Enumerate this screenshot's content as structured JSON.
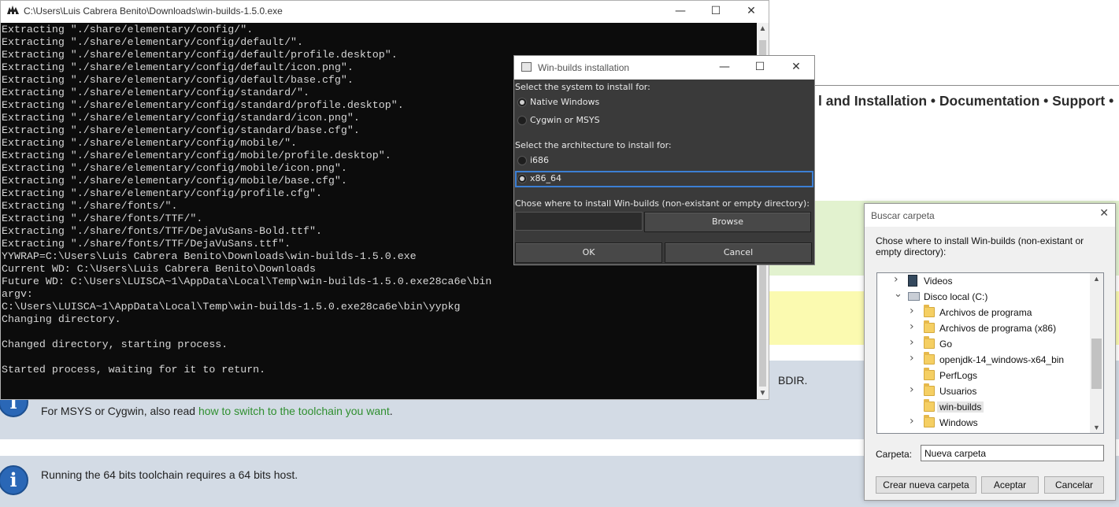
{
  "webpage": {
    "nav_text": "l and Installation • Documentation • Support •",
    "partial_text": "BDIR.",
    "info1_text": "For MSYS or Cygwin, also read ",
    "info1_link": "how to switch to the toolchain you want",
    "info1_after": ".",
    "info2_text": "Running the 64 bits toolchain requires a 64 bits host.",
    "info_icon_glyph": "i"
  },
  "console": {
    "title": "C:\\Users\\Luis Cabrera Benito\\Downloads\\win-builds-1.5.0.exe",
    "lines": [
      "Extracting \"./share/elementary/config/\".",
      "Extracting \"./share/elementary/config/default/\".",
      "Extracting \"./share/elementary/config/default/profile.desktop\".",
      "Extracting \"./share/elementary/config/default/icon.png\".",
      "Extracting \"./share/elementary/config/default/base.cfg\".",
      "Extracting \"./share/elementary/config/standard/\".",
      "Extracting \"./share/elementary/config/standard/profile.desktop\".",
      "Extracting \"./share/elementary/config/standard/icon.png\".",
      "Extracting \"./share/elementary/config/standard/base.cfg\".",
      "Extracting \"./share/elementary/config/mobile/\".",
      "Extracting \"./share/elementary/config/mobile/profile.desktop\".",
      "Extracting \"./share/elementary/config/mobile/icon.png\".",
      "Extracting \"./share/elementary/config/mobile/base.cfg\".",
      "Extracting \"./share/elementary/config/profile.cfg\".",
      "Extracting \"./share/fonts/\".",
      "Extracting \"./share/fonts/TTF/\".",
      "Extracting \"./share/fonts/TTF/DejaVuSans-Bold.ttf\".",
      "Extracting \"./share/fonts/TTF/DejaVuSans.ttf\".",
      "YYWRAP=C:\\Users\\Luis Cabrera Benito\\Downloads\\win-builds-1.5.0.exe",
      "Current WD: C:\\Users\\Luis Cabrera Benito\\Downloads",
      "Future WD: C:\\Users\\LUISCA~1\\AppData\\Local\\Temp\\win-builds-1.5.0.exe28ca6e\\bin",
      "argv:",
      "C:\\Users\\LUISCA~1\\AppData\\Local\\Temp\\win-builds-1.5.0.exe28ca6e\\bin\\yypkg",
      "Changing directory.",
      "",
      "Changed directory, starting process.",
      "",
      "Started process, waiting for it to return."
    ]
  },
  "wb_dialog": {
    "title": "Win-builds installation",
    "system_label": "Select the system to install for:",
    "system_options": [
      "Native Windows",
      "Cygwin or MSYS"
    ],
    "system_selected": "Native Windows",
    "arch_label": "Select the architecture to install for:",
    "arch_options": [
      "i686",
      "x86_64"
    ],
    "arch_selected": "x86_64",
    "dir_label": "Chose where to install Win-builds (non-existant or empty directory):",
    "dir_value": "",
    "browse_label": "Browse",
    "ok_label": "OK",
    "cancel_label": "Cancel"
  },
  "folder_dialog": {
    "title": "Buscar carpeta",
    "description": "Chose where to install Win-builds (non-existant or empty directory):",
    "tree": [
      {
        "label": "Videos",
        "icon": "video-folder-icon",
        "expander": "collapsed"
      },
      {
        "label": "Disco local (C:)",
        "icon": "drive-icon",
        "expander": "expanded"
      },
      {
        "label": "Archivos de programa",
        "icon": "folder-icon",
        "expander": "collapsed"
      },
      {
        "label": "Archivos de programa (x86)",
        "icon": "folder-icon",
        "expander": "collapsed"
      },
      {
        "label": "Go",
        "icon": "folder-icon",
        "expander": "collapsed"
      },
      {
        "label": "openjdk-14_windows-x64_bin",
        "icon": "folder-icon",
        "expander": "collapsed"
      },
      {
        "label": "PerfLogs",
        "icon": "folder-icon",
        "expander": "none"
      },
      {
        "label": "Usuarios",
        "icon": "folder-icon",
        "expander": "collapsed"
      },
      {
        "label": "win-builds",
        "icon": "folder-icon",
        "expander": "none",
        "selected": true
      },
      {
        "label": "Windows",
        "icon": "folder-icon",
        "expander": "collapsed"
      }
    ],
    "folder_label": "Carpeta:",
    "folder_value": "Nueva carpeta",
    "new_folder_label": "Crear nueva carpeta",
    "accept_label": "Aceptar",
    "cancel_label": "Cancelar"
  },
  "window_controls": {
    "minimize": "—",
    "maximize": "☐",
    "close": "✕"
  }
}
